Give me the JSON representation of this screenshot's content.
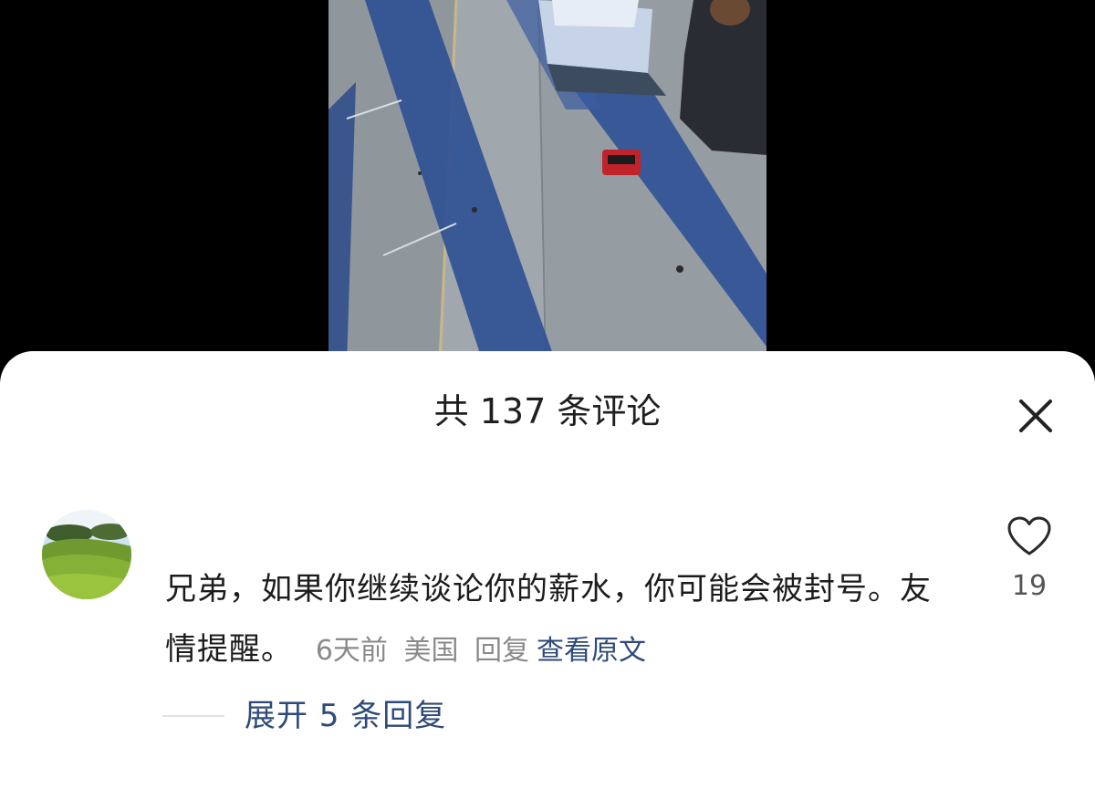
{
  "video": {
    "scene_icon": "rooftop-video-frame"
  },
  "comments_sheet": {
    "title": "共 137 条评论",
    "close_icon": "close-icon"
  },
  "comment": {
    "avatar_icon": "avatar-landscape-photo",
    "text": "兄弟，如果你继续谈论你的薪水，你可能会被封号。友情提醒。",
    "time_ago": "6天前",
    "location": "美国",
    "reply_label": "回复",
    "view_original_label": "查看原文",
    "like_icon": "heart-outline-icon",
    "like_count": "19",
    "expand_replies_label": "展开 5 条回复"
  },
  "colors": {
    "link_blue": "#2d4a7a",
    "meta_gray": "#8a8a8a",
    "text_dark": "#1c1c1c",
    "sheet_bg": "#ffffff",
    "backdrop": "#000000"
  }
}
